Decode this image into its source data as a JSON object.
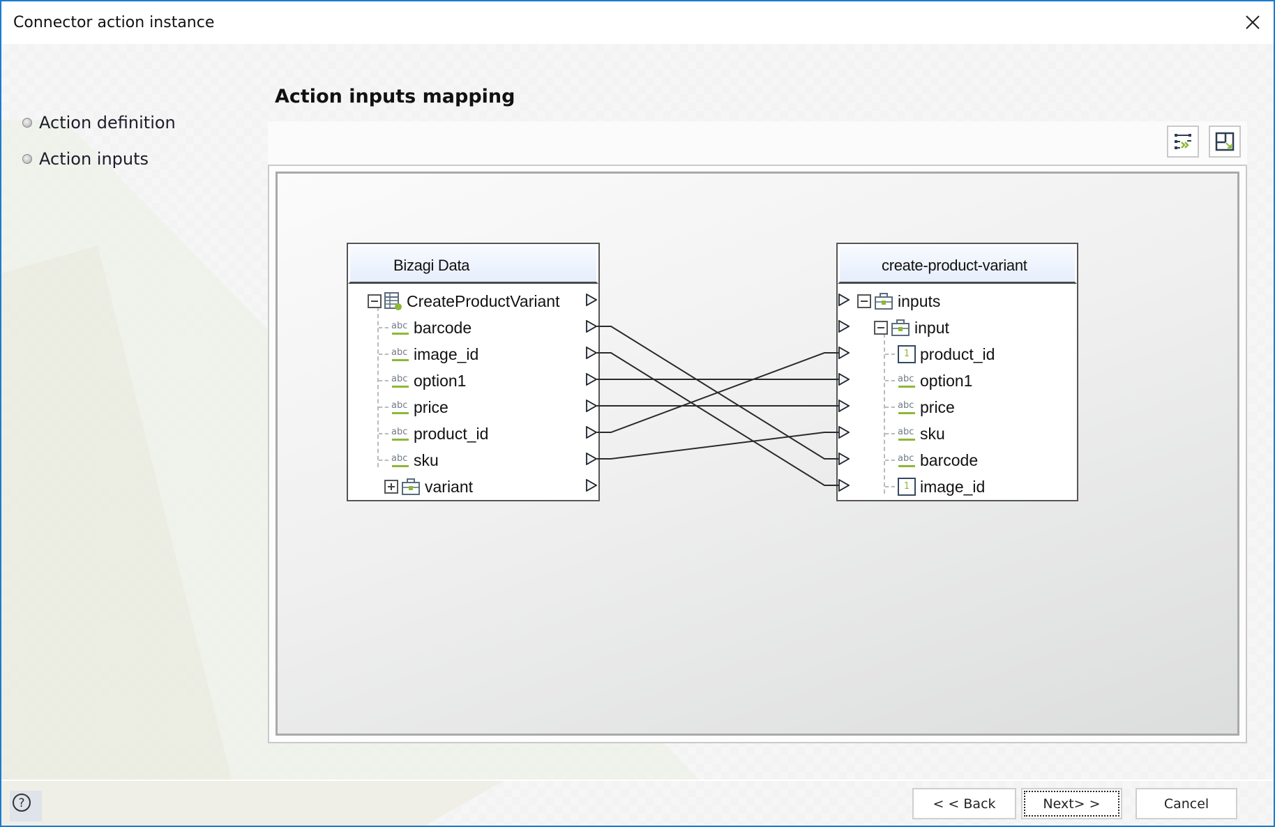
{
  "window": {
    "title": "Connector action instance",
    "close_icon": "close-icon"
  },
  "steps": [
    {
      "label": "Action definition"
    },
    {
      "label": "Action inputs"
    }
  ],
  "page": {
    "heading": "Action inputs mapping"
  },
  "toolbar": [
    {
      "name": "auto-map-button",
      "icon": "auto-map-icon"
    },
    {
      "name": "fit-layout-button",
      "icon": "layout-resize-icon"
    }
  ],
  "source": {
    "title": "Bizagi Data",
    "root": {
      "label": "CreateProductVariant",
      "icon": "entity-table-icon",
      "expanded": true
    },
    "fields": [
      {
        "label": "barcode",
        "type": "abc"
      },
      {
        "label": "image_id",
        "type": "abc"
      },
      {
        "label": "option1",
        "type": "abc"
      },
      {
        "label": "price",
        "type": "abc"
      },
      {
        "label": "product_id",
        "type": "abc"
      },
      {
        "label": "sku",
        "type": "abc"
      }
    ],
    "collapsed_child": {
      "label": "variant",
      "icon": "briefcase-icon",
      "expanded": false
    }
  },
  "target": {
    "title": "create-product-variant",
    "root": {
      "label": "inputs",
      "icon": "briefcase-icon",
      "expanded": true
    },
    "child": {
      "label": "input",
      "icon": "briefcase-icon",
      "expanded": true
    },
    "fields": [
      {
        "label": "product_id",
        "type": "number"
      },
      {
        "label": "option1",
        "type": "abc"
      },
      {
        "label": "price",
        "type": "abc"
      },
      {
        "label": "sku",
        "type": "abc"
      },
      {
        "label": "barcode",
        "type": "abc"
      },
      {
        "label": "image_id",
        "type": "number"
      }
    ]
  },
  "mappings": [
    {
      "from": "barcode",
      "to": "barcode"
    },
    {
      "from": "image_id",
      "to": "image_id"
    },
    {
      "from": "option1",
      "to": "option1"
    },
    {
      "from": "price",
      "to": "price"
    },
    {
      "from": "product_id",
      "to": "product_id"
    },
    {
      "from": "sku",
      "to": "sku"
    }
  ],
  "footer": {
    "help_icon": "help-icon",
    "back_label": "< < Back",
    "next_label": "Next> >",
    "cancel_label": "Cancel"
  },
  "colors": {
    "window_border": "#1a7bd0",
    "accent_green": "#8db836",
    "icon_dark": "#34495e"
  }
}
